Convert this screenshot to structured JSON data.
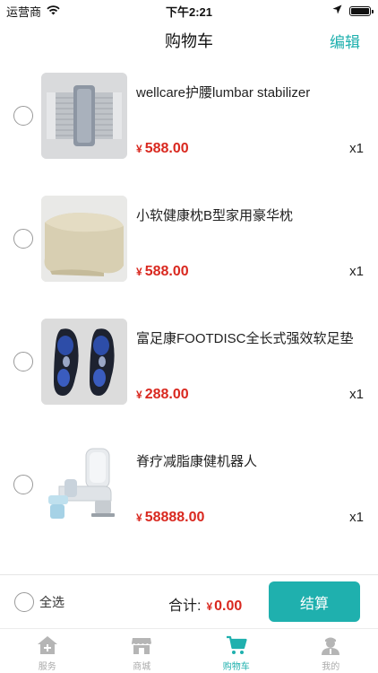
{
  "status_bar": {
    "carrier": "运营商",
    "time": "下午2:21"
  },
  "nav": {
    "title": "购物车",
    "edit_label": "编辑"
  },
  "cart_items": [
    {
      "name": "wellcare护腰lumbar stabilizer",
      "currency": "¥",
      "price": "588.00",
      "quantity": "x1",
      "image_icon": "lumbar-belt"
    },
    {
      "name": "小软健康枕B型家用豪华枕",
      "currency": "¥",
      "price": "588.00",
      "quantity": "x1",
      "image_icon": "pillow"
    },
    {
      "name": "富足康FOOTDISC全长式强效软足垫",
      "currency": "¥",
      "price": "288.00",
      "quantity": "x1",
      "image_icon": "insoles"
    },
    {
      "name": "脊疗减脂康健机器人",
      "currency": "¥",
      "price": "58888.00",
      "quantity": "x1",
      "image_icon": "massage-chair"
    }
  ],
  "checkout": {
    "select_all_label": "全选",
    "total_label": "合计:",
    "total_currency": "¥",
    "total_amount": "0.00",
    "checkout_label": "结算"
  },
  "tabs": [
    {
      "label": "服务",
      "icon": "house-plus-icon",
      "active": false
    },
    {
      "label": "商城",
      "icon": "store-icon",
      "active": false
    },
    {
      "label": "购物车",
      "icon": "cart-icon",
      "active": true
    },
    {
      "label": "我的",
      "icon": "user-icon",
      "active": false
    }
  ],
  "colors": {
    "accent": "#1fb0ae",
    "price": "#d9281f",
    "inactive_tab": "#aaaaaa"
  }
}
